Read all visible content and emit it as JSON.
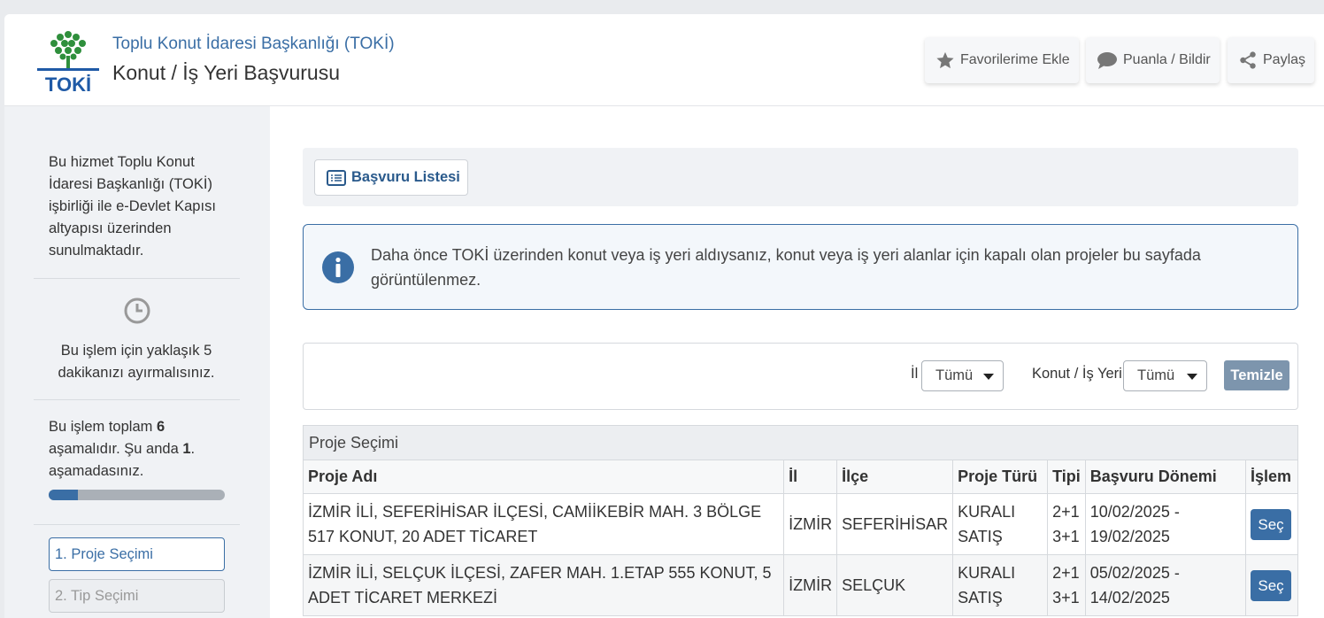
{
  "header": {
    "institution": "Toplu Konut İdaresi Başkanlığı (TOKİ)",
    "title": "Konut / İş Yeri Başvurusu",
    "logo_text": "TOKİ",
    "buttons": [
      {
        "label": "Favorilerime Ekle",
        "icon": "star-icon"
      },
      {
        "label": "Puanla / Bildir",
        "icon": "comment-icon"
      },
      {
        "label": "Paylaş",
        "icon": "share-icon"
      }
    ]
  },
  "sidebar": {
    "service_info": "Bu hizmet Toplu Konut İdaresi Başkanlığı (TOKİ) işbirliği ile e-Devlet Kapısı altyapısı üzerinden sunulmaktadır.",
    "time_info": "Bu işlem için yaklaşık 5 dakikanızı ayırmalısınız.",
    "steps_prefix": "Bu işlem toplam ",
    "steps_total": "6",
    "steps_middle": " aşamalıdır. Şu anda ",
    "steps_current": "1",
    "steps_suffix": ". aşamadasınız.",
    "progress_fraction": 0.1667,
    "steps": [
      {
        "label": "1. Proje Seçimi"
      },
      {
        "label": "2. Tip Seçimi"
      }
    ]
  },
  "toolbar": {
    "list_button": "Başvuru Listesi"
  },
  "info": {
    "text": "Daha önce TOKİ üzerinden konut veya iş yeri aldıysanız, konut veya iş yeri alanlar için kapalı olan projeler bu sayfada görüntülenmez."
  },
  "filter": {
    "il_label": "İl",
    "il_value": "Tümü",
    "type_label": "Konut / İş Yeri",
    "type_value": "Tümü",
    "clear_button": "Temizle"
  },
  "table": {
    "section_title": "Proje Seçimi",
    "headers": [
      "Proje Adı",
      "İl",
      "İlçe",
      "Proje Türü",
      "Tipi",
      "Başvuru Dönemi",
      "İşlem"
    ],
    "rows": [
      {
        "name": "İZMİR İLİ, SEFERİHİSAR İLÇESİ, CAMİİKEBİR MAH. 3 BÖLGE 517 KONUT, 20 ADET TİCARET",
        "il": "İZMİR",
        "ilce": "SEFERİHİSAR",
        "type_line1": "KURALI",
        "type_line2": "SATIŞ",
        "tip_line1": "2+1",
        "tip_line2": "3+1",
        "period_line1": "10/02/2025 -",
        "period_line2": "19/02/2025",
        "action": "Seç"
      },
      {
        "name": "İZMİR İLİ, SELÇUK İLÇESİ, ZAFER MAH. 1.ETAP 555 KONUT, 5 ADET TİCARET MERKEZİ",
        "il": "İZMİR",
        "ilce": "SELÇUK",
        "type_line1": "KURALI",
        "type_line2": "SATIŞ",
        "tip_line1": "2+1",
        "tip_line2": "3+1",
        "period_line1": "05/02/2025 -",
        "period_line2": "14/02/2025",
        "action": "Seç"
      }
    ]
  }
}
